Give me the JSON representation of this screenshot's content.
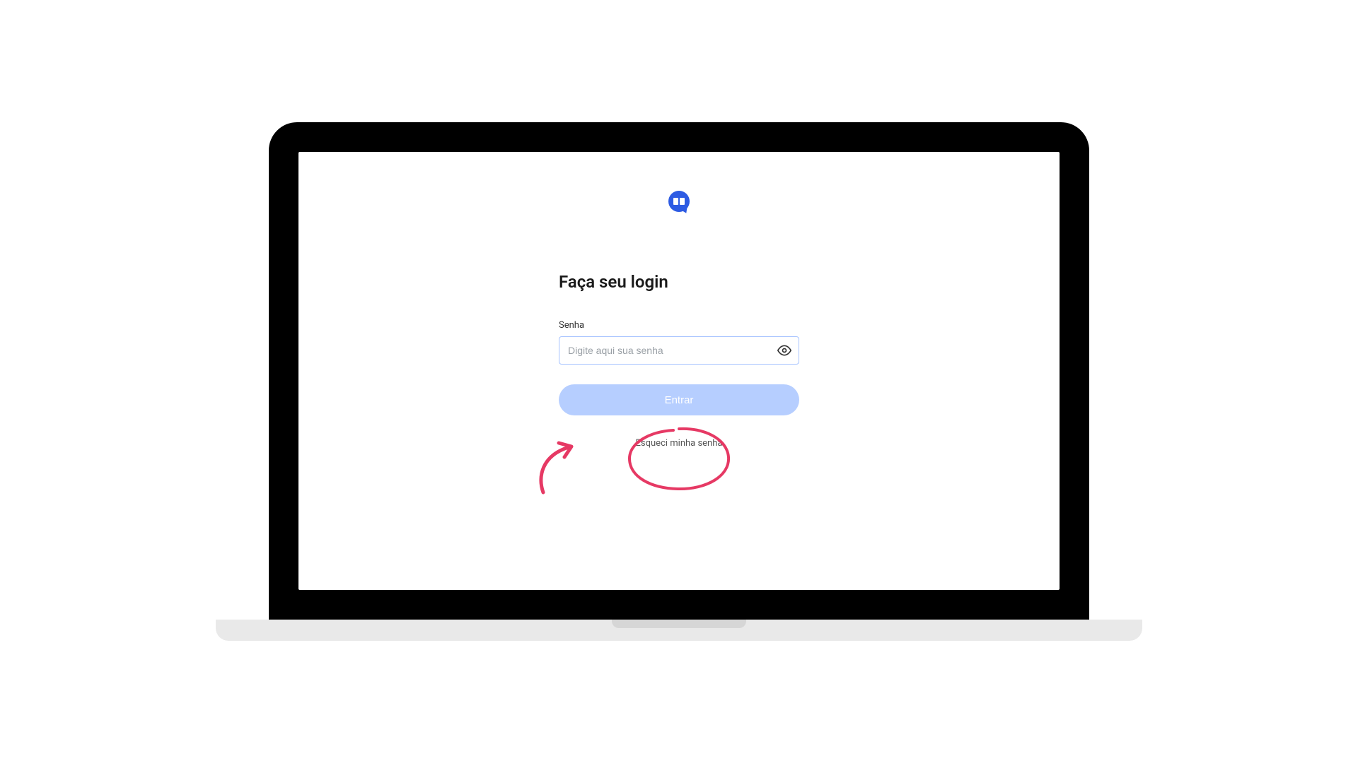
{
  "login": {
    "heading": "Faça seu login",
    "password_label": "Senha",
    "password_placeholder": "Digite aqui sua senha",
    "submit_label": "Entrar",
    "forgot_label": "Esqueci minha senha"
  },
  "colors": {
    "accent": "#2d5be3",
    "button_disabled": "#b6ceff",
    "input_border": "#a6c3ff",
    "annotation": "#e63964"
  }
}
